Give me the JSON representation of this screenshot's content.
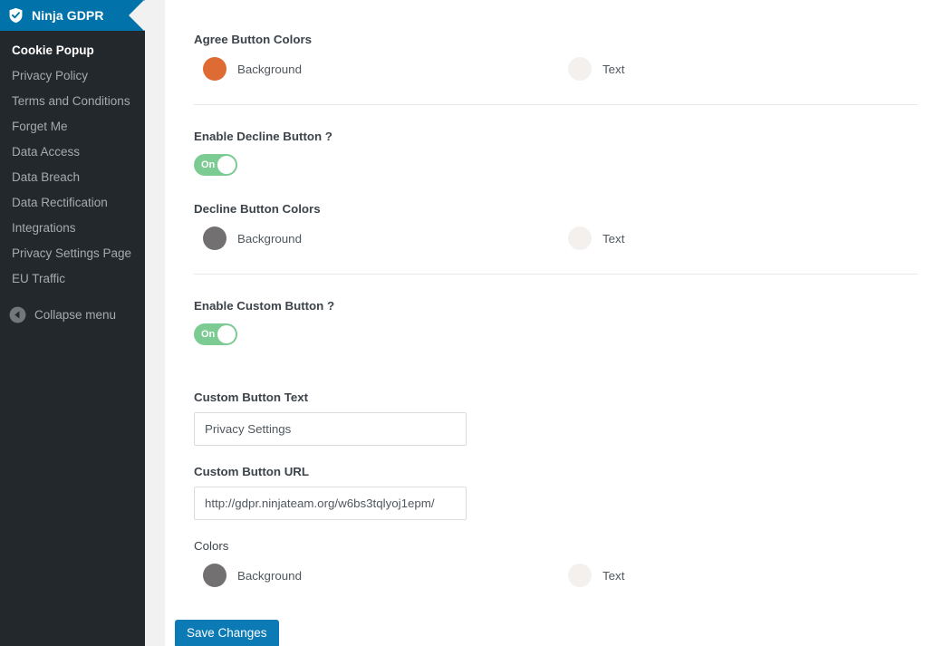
{
  "sidebar": {
    "brand": {
      "title": "Ninja GDPR",
      "icon": "shield-check-icon",
      "bg_color": "#0173AA"
    },
    "items": [
      {
        "label": "Cookie Popup",
        "active": true
      },
      {
        "label": "Privacy Policy",
        "active": false
      },
      {
        "label": "Terms and Conditions",
        "active": false
      },
      {
        "label": "Forget Me",
        "active": false
      },
      {
        "label": "Data Access",
        "active": false
      },
      {
        "label": "Data Breach",
        "active": false
      },
      {
        "label": "Data Rectification",
        "active": false
      },
      {
        "label": "Integrations",
        "active": false
      },
      {
        "label": "Privacy Settings Page",
        "active": false
      },
      {
        "label": "EU Traffic",
        "active": false
      }
    ],
    "collapse": {
      "label": "Collapse menu",
      "icon": "caret-left-circle-icon"
    }
  },
  "main": {
    "agree_colors": {
      "label": "Agree Button Colors",
      "background": {
        "label": "Background",
        "color": "#DD6B33"
      },
      "text": {
        "label": "Text",
        "color": "#F4F0EE"
      }
    },
    "enable_decline": {
      "label": "Enable Decline Button ?",
      "toggle_state": "On",
      "toggle_color": "#7CCB93"
    },
    "decline_colors": {
      "label": "Decline Button Colors",
      "background": {
        "label": "Background",
        "color": "#727071"
      },
      "text": {
        "label": "Text",
        "color": "#F4F0EE"
      }
    },
    "enable_custom": {
      "label": "Enable Custom Button ?",
      "toggle_state": "On",
      "toggle_color": "#7CCB93"
    },
    "custom_button_text": {
      "label": "Custom Button Text",
      "value": "Privacy Settings",
      "placeholder": "Custom Button Text"
    },
    "custom_button_url": {
      "label": "Custom Button URL",
      "value": "http://gdpr.ninjateam.org/w6bs3tqlyoj1epm/",
      "placeholder": "Custom Button URL"
    },
    "custom_colors": {
      "label": "Colors",
      "background": {
        "label": "Background",
        "color": "#727071"
      },
      "text": {
        "label": "Text",
        "color": "#F4F0EE"
      }
    },
    "save": {
      "label": "Save Changes",
      "color": "#0C7AB5"
    }
  }
}
